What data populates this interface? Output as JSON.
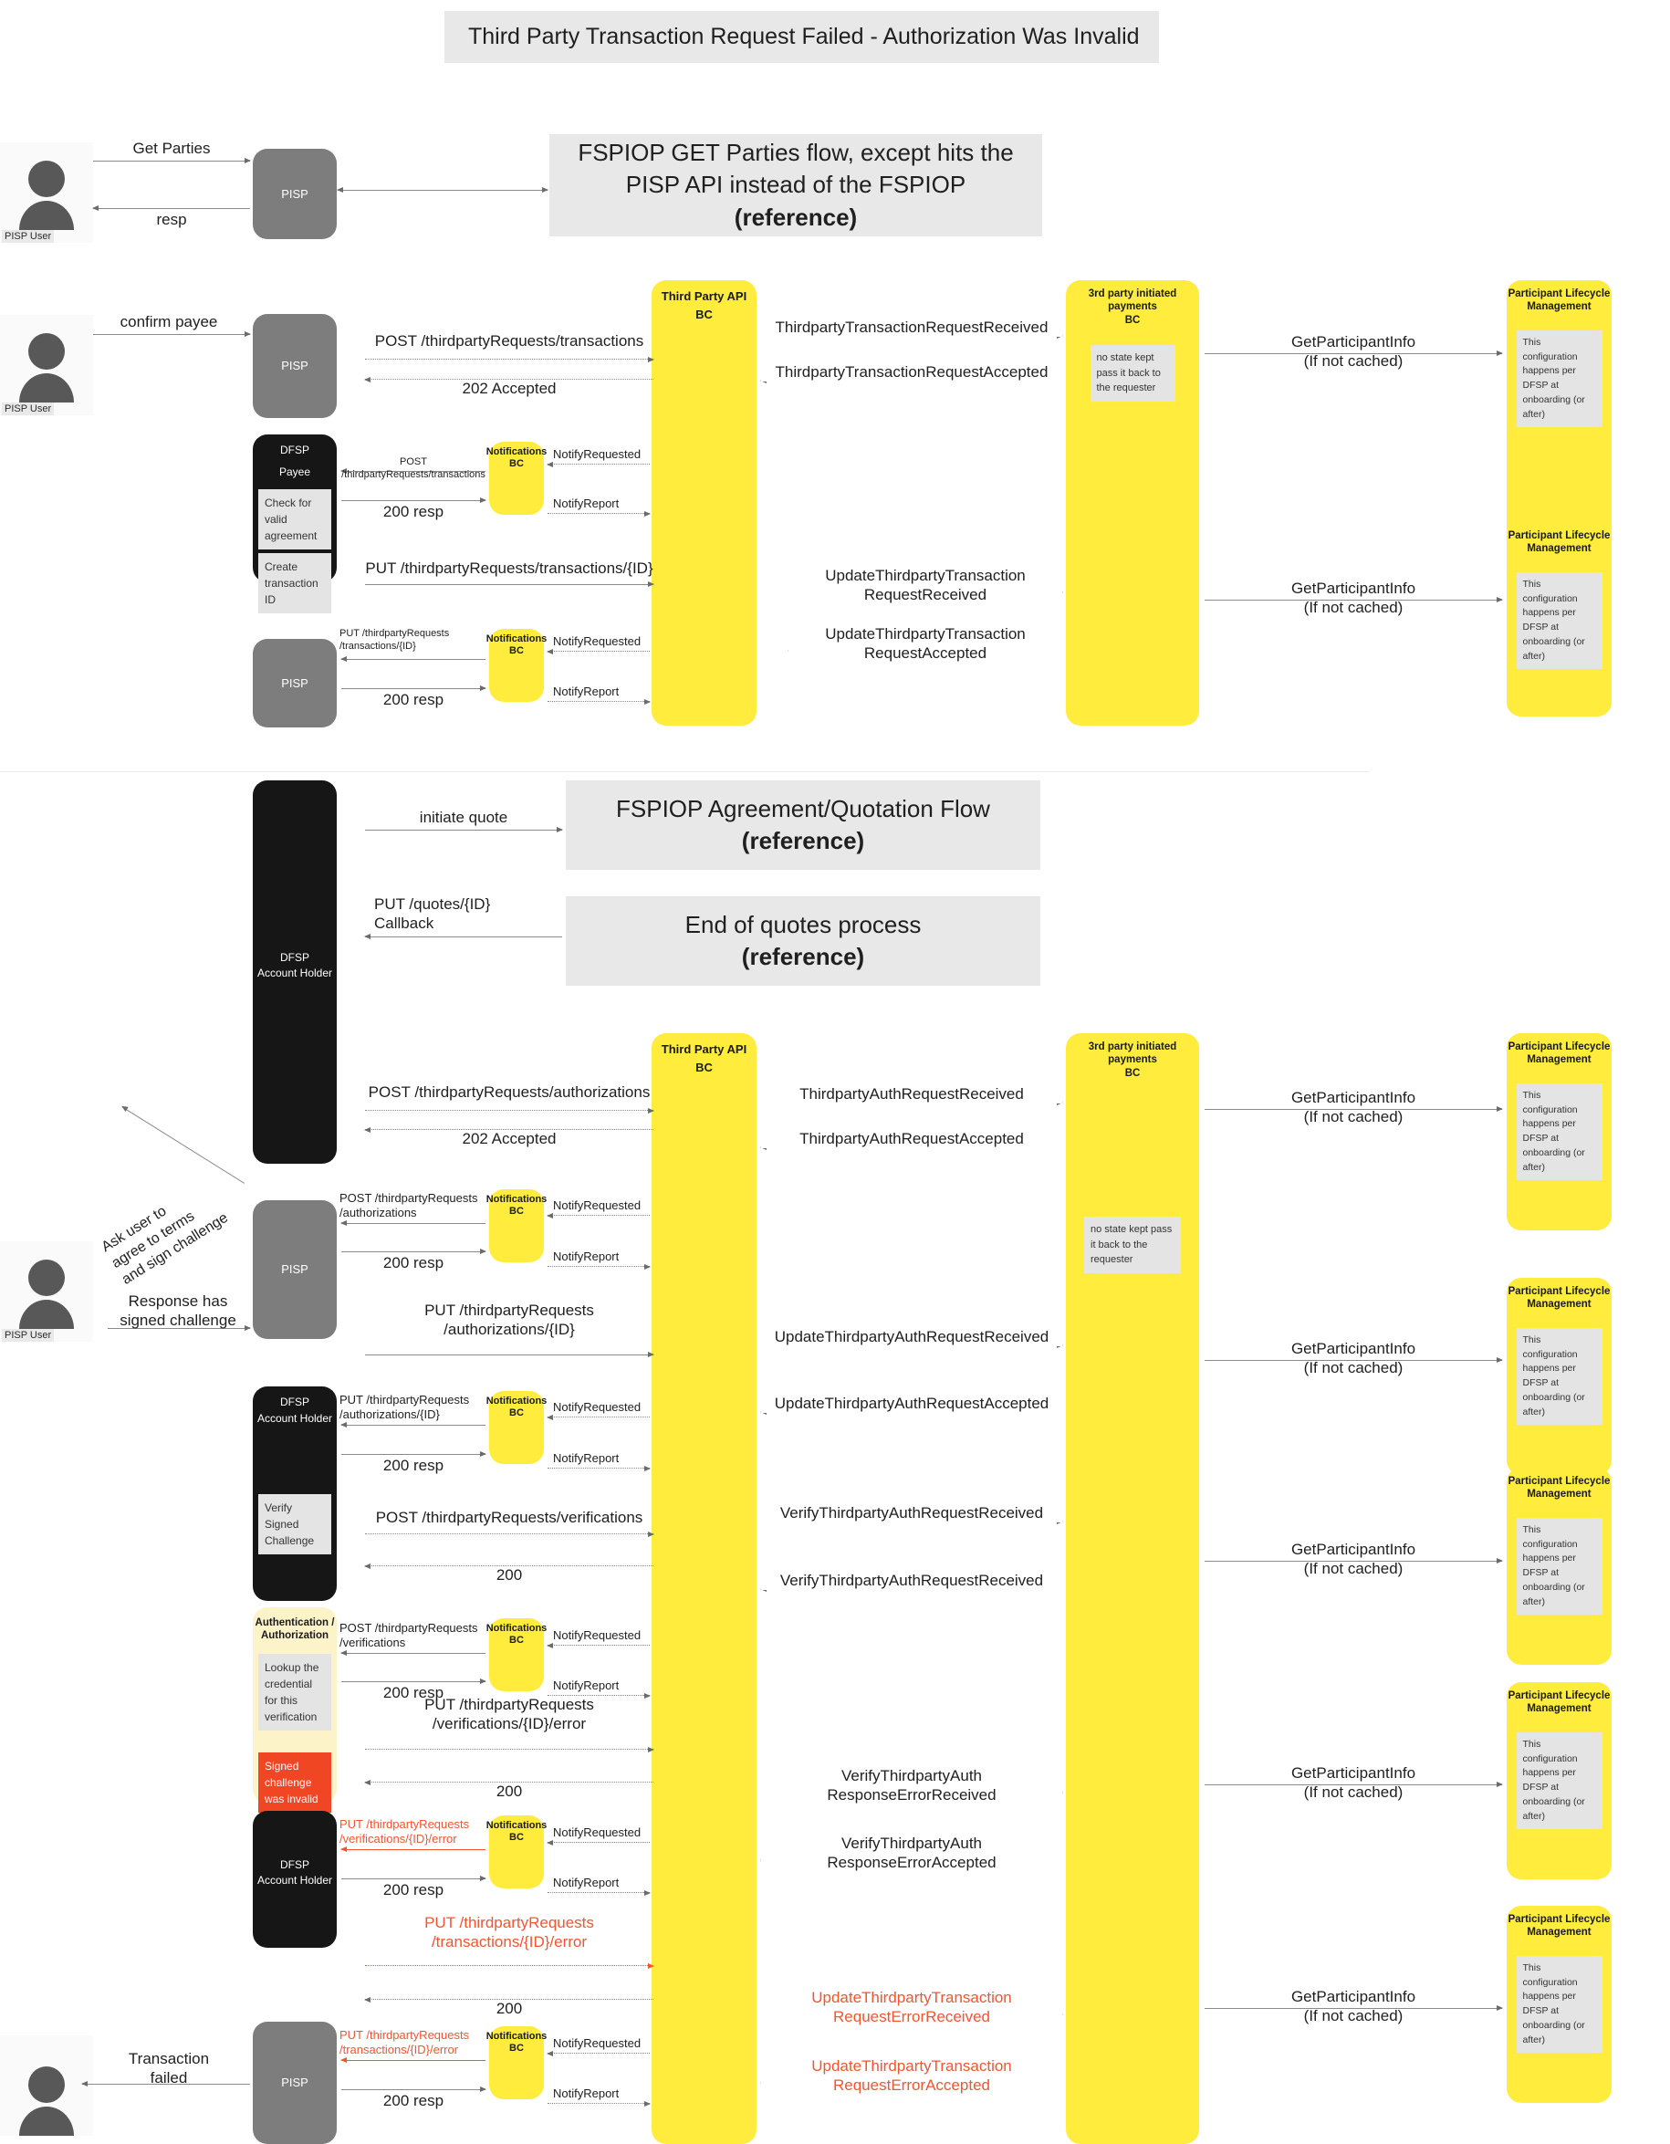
{
  "diagram": {
    "title": "Third Party Transaction Request Failed - Authorization Was Invalid",
    "type": "sequence-diagram"
  },
  "actors": {
    "pisp_user": "PISP User",
    "pisp": "PISP",
    "dfsp_payee_line1": "DFSP",
    "dfsp_payee_line2": "Payee",
    "dfsp_account_holder_line1": "DFSP",
    "dfsp_account_holder_line2": "Account Holder",
    "notifications_bc": "Notifications\nBC",
    "third_party_api_bc": "Third Party API BC",
    "third_party_payments_bc": "3rd party initiated payments\nBC",
    "participant_lifecycle": "Participant Lifecycle\nManagement",
    "auth_authz": "Authentication /\nAuthorization"
  },
  "banners": {
    "fspiop_get_parties": "FSPIOP GET Parties flow, except hits the PISP API instead of the FSPIOP",
    "fspiop_get_parties_ref": "(reference)",
    "fspiop_agreement": "FSPIOP Agreement/Quotation Flow",
    "fspiop_agreement_ref": "(reference)",
    "end_of_quotes": "End of quotes process",
    "end_of_quotes_ref": "(reference)"
  },
  "notes": {
    "no_state_kept_1": "no state kept\npass it back to the\nrequester",
    "no_state_kept_2": "no state kept pass it\nback to the requester",
    "plm_config": "This configuration\nhappens per DFSP at\nonboarding (or after)",
    "check_valid_agreement": "Check for valid\nagreement",
    "create_transaction_id": "Create\ntransaction ID",
    "verify_signed_challenge": "Verify Signed\nChallenge",
    "lookup_credential": "Lookup the\ncredential for\nthis\nverification",
    "signed_challenge_invalid": "Signed\nchallenge was\ninvalid"
  },
  "messages": {
    "get_parties": "Get Parties",
    "resp": "resp",
    "confirm_payee": "confirm payee",
    "post_tpr_transactions": "POST /thirdpartyRequests/transactions",
    "accepted_202": "202 Accepted",
    "post_tpr_transactions_sm": "POST /thirdpartyRequests/transactions",
    "resp_200": "200 resp",
    "resp_200_plain": "200",
    "notify_requested": "NotifyRequested",
    "notify_report": "NotifyReport",
    "put_tpr_transactions_id": "PUT /thirdpartyRequests/transactions/{ID}",
    "put_tpr_transactions_id_wrapped": "PUT /thirdpartyRequests\n/transactions/{ID}",
    "tp_txn_request_received": "ThirdpartyTransactionRequestReceived",
    "tp_txn_request_accepted": "ThirdpartyTransactionRequestAccepted",
    "update_tp_txn_request_received": "UpdateThirdpartyTransaction\nRequestReceived",
    "update_tp_txn_request_accepted": "UpdateThirdpartyTransaction\nRequestAccepted",
    "get_participant_info": "GetParticipantInfo\n(If not cached)",
    "initiate_quote": "initiate quote",
    "put_quotes_id_callback": "PUT /quotes/{ID}\nCallback",
    "post_tpr_authorizations": "POST /thirdpartyRequests/authorizations",
    "post_tpr_authorizations_wrapped": "POST /thirdpartyRequests\n/authorizations",
    "tp_auth_request_received": "ThirdpartyAuthRequestReceived",
    "tp_auth_request_accepted": "ThirdpartyAuthRequestAccepted",
    "put_tpr_authorizations_id": "PUT /thirdpartyRequests\n/authorizations/{ID}",
    "update_tp_auth_request_received": "UpdateThirdpartyAuthRequestReceived",
    "update_tp_auth_request_accepted": "UpdateThirdpartyAuthRequestAccepted",
    "post_tpr_verifications": "POST /thirdpartyRequests/verifications",
    "post_tpr_verifications_wrapped": "POST /thirdpartyRequests\n/verifications",
    "verify_tp_auth_request_received": "VerifyThirdpartyAuthRequestReceived",
    "put_tpr_verifications_id_error": "PUT /thirdpartyRequests\n/verifications/{ID}/error",
    "verify_tp_auth_response_error_received": "VerifyThirdpartyAuth\nResponseErrorReceived",
    "verify_tp_auth_response_error_accepted": "VerifyThirdpartyAuth\nResponseErrorAccepted",
    "put_tpr_transactions_id_error": "PUT /thirdpartyRequests\n/transactions/{ID}/error",
    "update_tp_txn_request_error_received": "UpdateThirdpartyTransaction\nRequestErrorReceived",
    "update_tp_txn_request_error_accepted": "UpdateThirdpartyTransaction\nRequestErrorAccepted",
    "ask_user_sign": "Ask user to\nagree to terms\nand sign challenge",
    "response_signed_challenge": "Response has\nsigned challenge",
    "transaction_failed": "Transaction\nfailed"
  },
  "colors": {
    "yellow": "#ffec3d",
    "light_yellow": "#fdf3c8",
    "gray_actor": "#7d7d7d",
    "black_actor": "#161616",
    "banner_gray": "#e8e8e8",
    "note_gray": "#e4e4e4",
    "error_red": "#f4552e",
    "note_red": "#f04623"
  }
}
